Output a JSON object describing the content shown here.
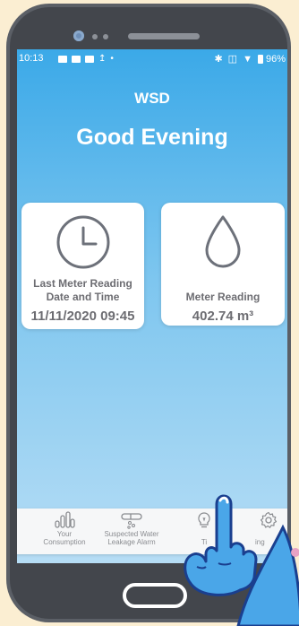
{
  "status_bar": {
    "time": "10:13",
    "battery": "96%"
  },
  "header": {
    "title": "WSD",
    "greeting": "Good Evening"
  },
  "cards": {
    "last_reading": {
      "label_line1": "Last Meter Reading",
      "label_line2": "Date and Time",
      "value": "11/11/2020 09:45",
      "icon": "clock-icon"
    },
    "meter_reading": {
      "label": "Meter Reading",
      "value": "402.74 m³",
      "icon": "water-drop-icon"
    }
  },
  "nav": {
    "consumption": {
      "line1": "Your",
      "line2": "Consumption",
      "icon": "bar-chart-icon"
    },
    "leakage": {
      "line1": "Suspected Water",
      "line2": "Leakage Alarm",
      "icon": "pipe-leak-icon"
    },
    "tips": {
      "label": "Ti",
      "icon": "lightbulb-icon"
    },
    "settings": {
      "label": "ing",
      "icon": "gear-icon"
    }
  },
  "colors": {
    "accent": "#3ba9e8",
    "text_gray": "#6d6d72"
  }
}
